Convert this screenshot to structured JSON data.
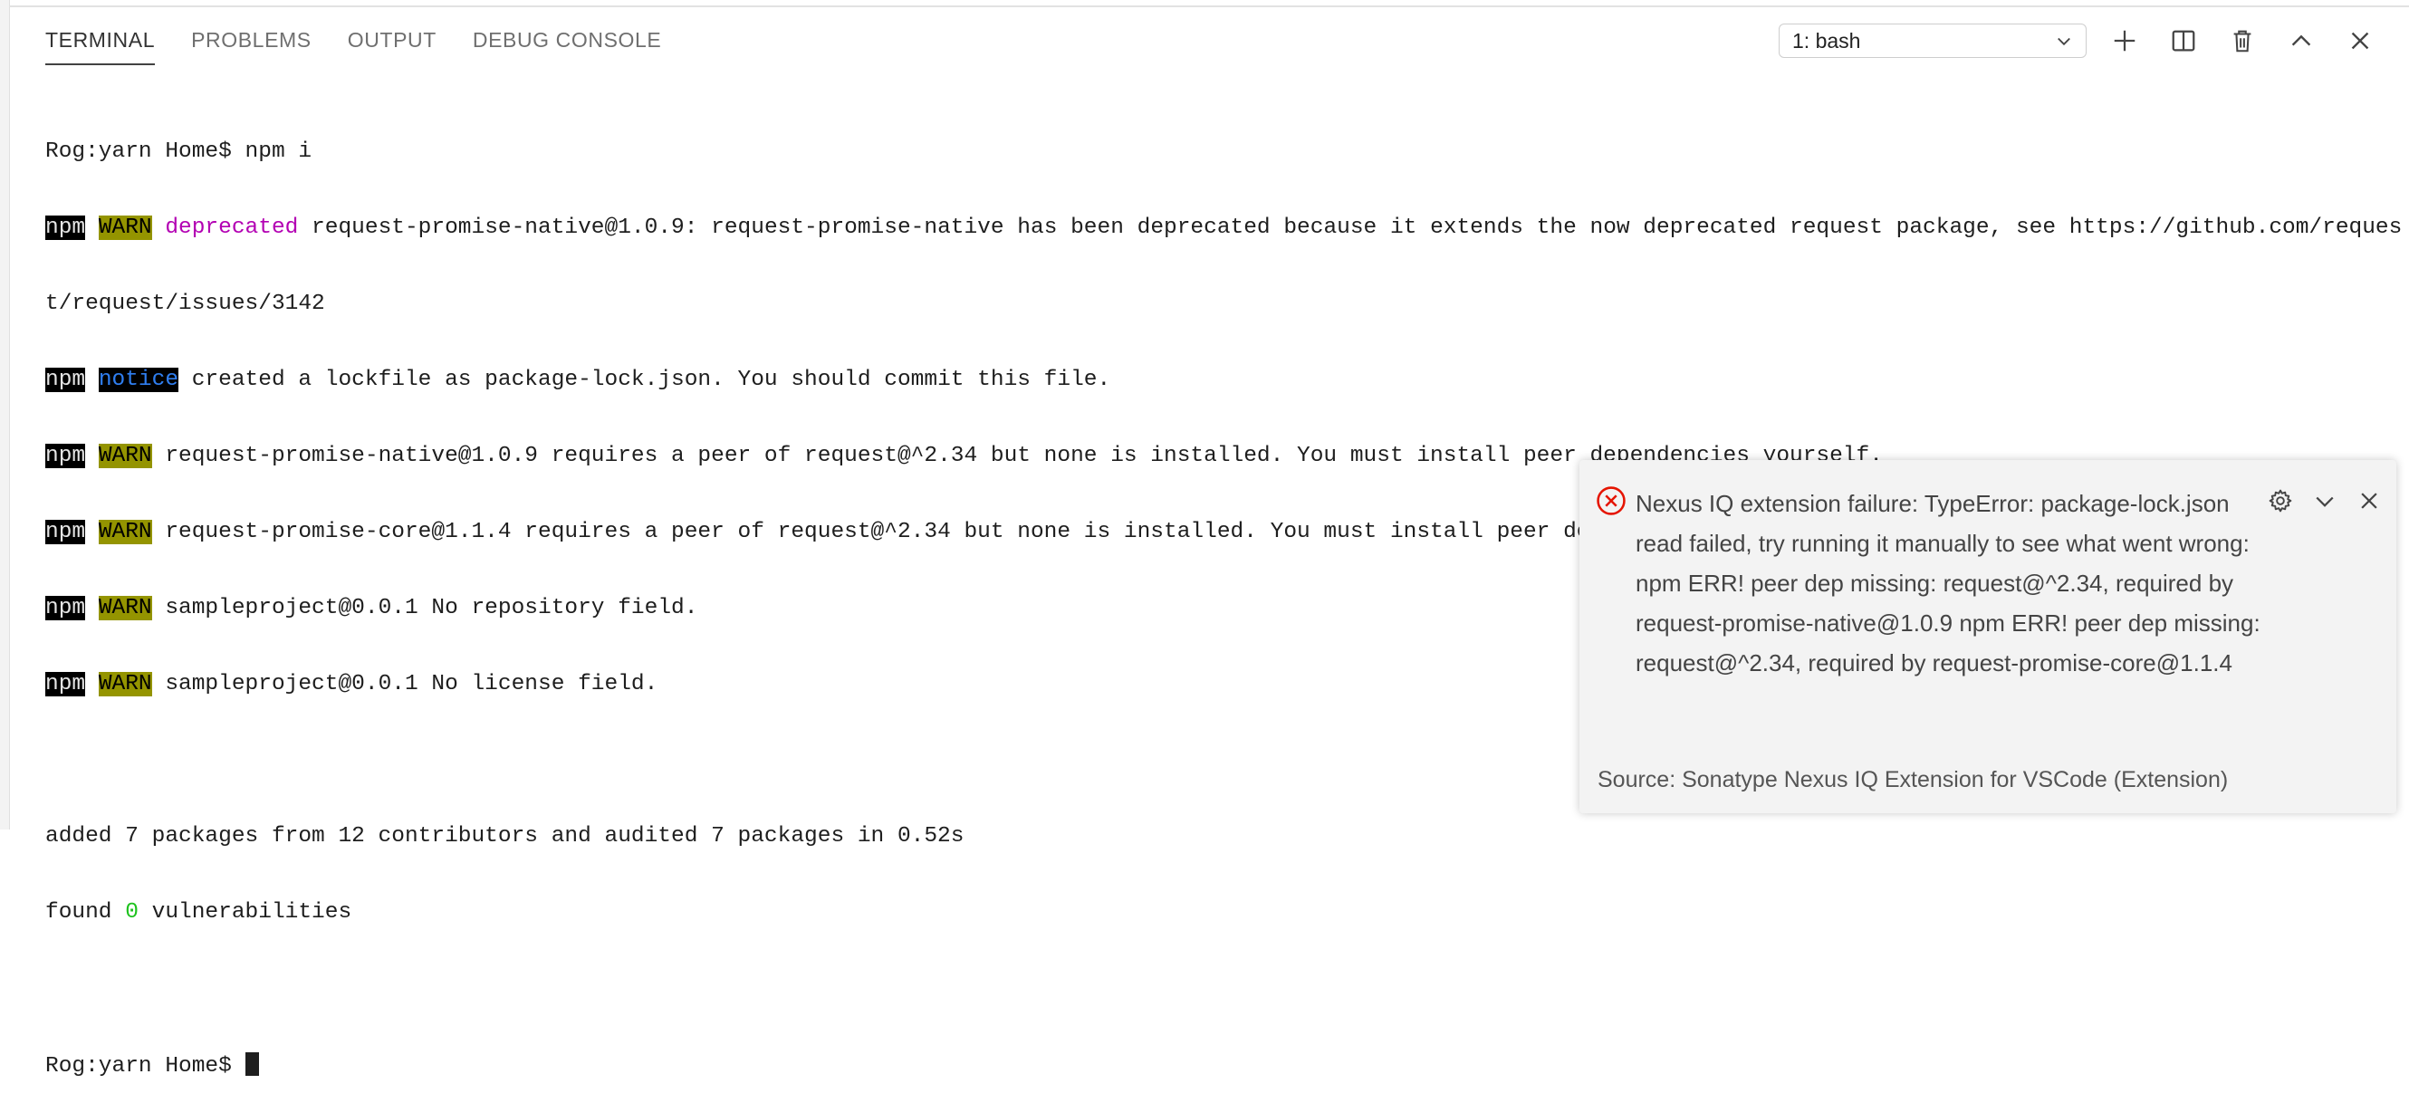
{
  "tabs": [
    {
      "label": "TERMINAL",
      "active": true
    },
    {
      "label": "PROBLEMS",
      "active": false
    },
    {
      "label": "OUTPUT",
      "active": false
    },
    {
      "label": "DEBUG CONSOLE",
      "active": false
    }
  ],
  "toolbar": {
    "terminal_select": "1: bash",
    "icons": [
      "chevron-down-icon",
      "plus-icon",
      "split-icon",
      "trash-icon",
      "chevron-up-icon",
      "close-icon"
    ]
  },
  "terminal": {
    "l1": "Rog:yarn Home$ npm i",
    "l2_npm": "npm",
    "l2_warn": "WARN",
    "l2_dep": "deprecated",
    "l2_text": " request-promise-native@1.0.9: request-promise-native has been deprecated because it extends the now deprecated request package, see https://github.com/reques",
    "l3": "t/request/issues/3142",
    "l4_npm": "npm",
    "l4_notice": "notice",
    "l4_text": " created a lockfile as package-lock.json. You should commit this file.",
    "l5_npm": "npm",
    "l5_warn": "WARN",
    "l5_text": " request-promise-native@1.0.9 requires a peer of request@^2.34 but none is installed. You must install peer dependencies yourself.",
    "l6_npm": "npm",
    "l6_warn": "WARN",
    "l6_text": " request-promise-core@1.1.4 requires a peer of request@^2.34 but none is installed. You must install peer dependencies yourself.",
    "l7_npm": "npm",
    "l7_warn": "WARN",
    "l7_text": " sampleproject@0.0.1 No repository field.",
    "l8_npm": "npm",
    "l8_warn": "WARN",
    "l8_text": " sampleproject@0.0.1 No license field.",
    "l10": "added 7 packages from 12 contributors and audited 7 packages in 0.52s",
    "l11_pre": "found ",
    "l11_num": "0",
    "l11_post": " vulnerabilities",
    "l13": "Rog:yarn Home$ "
  },
  "notification": {
    "icon": "error-icon",
    "message": "Nexus IQ extension failure: TypeError: package-lock.json read failed, try running it manually to see what went wrong: npm ERR! peer dep missing: request@^2.34, required by request-promise-native@1.0.9 npm ERR! peer dep missing: request@^2.34, required by request-promise-core@1.1.4",
    "source": "Source: Sonatype Nexus IQ Extension for VSCode (Extension)",
    "actions": [
      "gear-icon",
      "chevron-down-icon",
      "close-icon"
    ]
  },
  "colors": {
    "warn_bg": "#949400",
    "deprecated": "#b300b3",
    "notice": "#2f7ef0",
    "success": "#1ec21e",
    "error": "#e51400"
  }
}
